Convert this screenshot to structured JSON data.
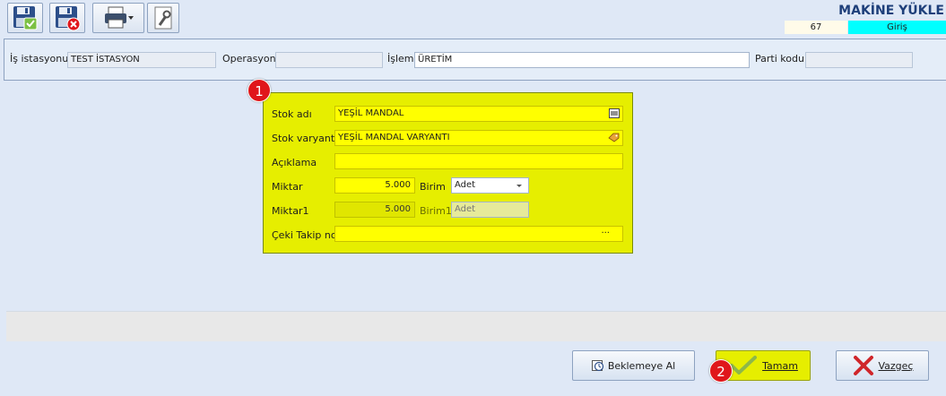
{
  "header": {
    "title": "MAKİNE YÜKLE",
    "counter": "67",
    "mode": "Giriş"
  },
  "toolbar": {
    "save_icon": "save-check-icon",
    "cancel_icon": "save-cancel-icon",
    "print_icon": "printer-icon",
    "tools_icon": "wrench-icon"
  },
  "top": {
    "is_istasyonu_label": "İş istasyonu",
    "is_istasyonu_value": "TEST İSTASYON",
    "operasyon_label": "Operasyon",
    "operasyon_value": "",
    "islem_label": "İşlem",
    "islem_value": "ÜRETİM",
    "parti_label": "Parti kodu",
    "parti_value": ""
  },
  "form": {
    "stok_adi_label": "Stok adı",
    "stok_adi_value": "YEŞİL MANDAL",
    "stok_varyant_label": "Stok varyantı",
    "stok_varyant_value": "YEŞİL MANDAL VARYANTI",
    "aciklama_label": "Açıklama",
    "aciklama_value": "",
    "miktar_label": "Miktar",
    "miktar_value": "5.000",
    "birim_label": "Birim",
    "birim_value": "Adet",
    "miktar1_label": "Miktar1",
    "miktar1_value": "5.000",
    "birim1_label": "Birim1",
    "birim1_value": "Adet",
    "ceki_label": "Çeki Takip no",
    "ceki_value": "",
    "ellipsis": "···"
  },
  "badges": {
    "one": "1",
    "two": "2"
  },
  "buttons": {
    "beklemeye": "Beklemeye Al",
    "tamam": "Tamam",
    "vazgec": "Vazgeç"
  },
  "colors": {
    "form_bg": "#e6ee00",
    "field_bg": "#ffff00",
    "giris_bg": "#00ffff",
    "badge": "#e0161b",
    "title": "#1e3f7a"
  }
}
